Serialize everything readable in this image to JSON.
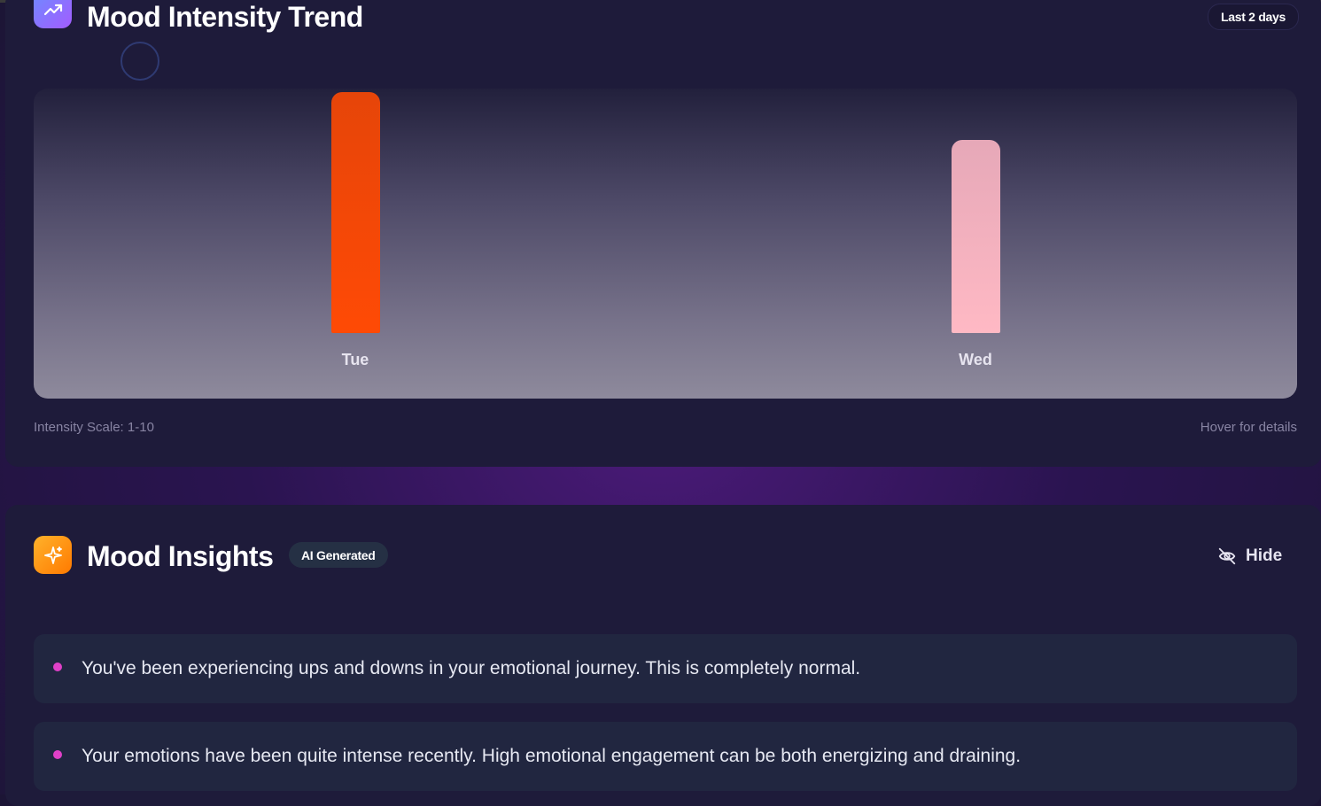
{
  "trend_card": {
    "title": "Mood Intensity Trend",
    "range_label": "Last 2 days",
    "scale_note": "Intensity Scale: 1-10",
    "hover_note": "Hover for details"
  },
  "chart_data": {
    "type": "bar",
    "categories": [
      "Tue",
      "Wed"
    ],
    "values": [
      10,
      8
    ],
    "ylim": [
      0,
      10
    ],
    "colors": [
      "#ff4a05",
      "#ffb9c4"
    ],
    "grid": false
  },
  "insights_card": {
    "title": "Mood Insights",
    "badge": "AI Generated",
    "hide_label": "Hide",
    "items": [
      {
        "text": "You've been experiencing ups and downs in your emotional journey. This is completely normal."
      },
      {
        "text": "Your emotions have been quite intense recently. High emotional engagement can be both energizing and draining."
      }
    ]
  },
  "icons": {
    "trend": "trending-up-icon",
    "insights": "sparkles-icon",
    "hide": "eye-off-icon"
  },
  "colors": {
    "accent_trend": "#8a6dff",
    "accent_insights": "#ff9a1a",
    "bullet": "#e040c8"
  }
}
